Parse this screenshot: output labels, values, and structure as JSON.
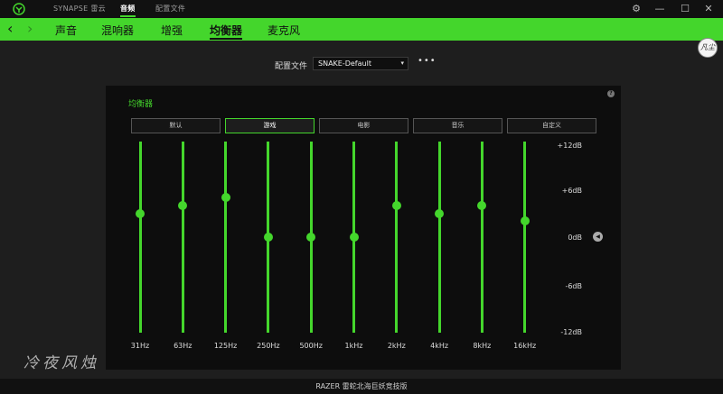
{
  "app": {
    "top_tabs": [
      "SYNAPSE 雷云",
      "音频",
      "配置文件"
    ],
    "window_controls": {
      "settings": "⚙",
      "minimize": "—",
      "maximize": "☐",
      "close": "✕"
    }
  },
  "nav": {
    "back": "‹",
    "forward": "›",
    "items": [
      "声音",
      "混响器",
      "增强",
      "均衡器",
      "麦克风"
    ],
    "avatar_text": "凡尘"
  },
  "profile": {
    "label": "配置文件",
    "value": "SNAKE-Default",
    "caret": "▾",
    "more": "•••"
  },
  "eq": {
    "title": "均衡器",
    "help": "?",
    "presets": [
      "默认",
      "游戏",
      "电影",
      "音乐",
      "自定义"
    ],
    "active_preset": "游戏",
    "bands": [
      {
        "freq": "31Hz",
        "gain_db": 3
      },
      {
        "freq": "63Hz",
        "gain_db": 4
      },
      {
        "freq": "125Hz",
        "gain_db": 5
      },
      {
        "freq": "250Hz",
        "gain_db": 0
      },
      {
        "freq": "500Hz",
        "gain_db": 0
      },
      {
        "freq": "1kHz",
        "gain_db": 0
      },
      {
        "freq": "2kHz",
        "gain_db": 4
      },
      {
        "freq": "4kHz",
        "gain_db": 3
      },
      {
        "freq": "8kHz",
        "gain_db": 4
      },
      {
        "freq": "16kHz",
        "gain_db": 2
      }
    ],
    "db_range": [
      -12,
      12
    ],
    "db_labels": [
      "+12dB",
      "+6dB",
      "0dB",
      "-6dB",
      "-12dB"
    ],
    "collapse_icon": "◀",
    "accent_color": "#44d62c"
  },
  "watermark": "冷夜风烛",
  "footer": "RAZER 雷蛇北海巨妖竞技版"
}
